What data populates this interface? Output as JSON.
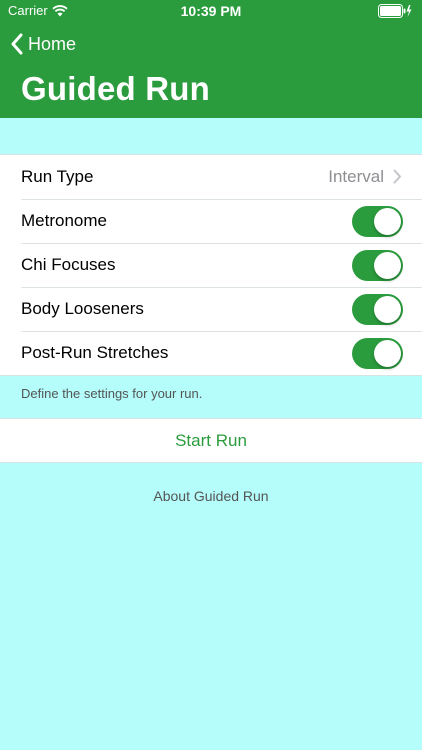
{
  "status_bar": {
    "carrier": "Carrier",
    "time": "10:39 PM"
  },
  "nav": {
    "back_label": "Home",
    "title": "Guided Run"
  },
  "settings": {
    "run_type": {
      "label": "Run Type",
      "value": "Interval"
    },
    "toggles": [
      {
        "label": "Metronome",
        "on": true
      },
      {
        "label": "Chi Focuses",
        "on": true
      },
      {
        "label": "Body Looseners",
        "on": true
      },
      {
        "label": "Post-Run Stretches",
        "on": true
      }
    ],
    "footer": "Define the settings for your run."
  },
  "actions": {
    "start_run": "Start Run",
    "about": "About Guided Run"
  },
  "colors": {
    "accent": "#2b9c3e",
    "background": "#b4fdfa"
  },
  "icons": {
    "back": "chevron-left-icon",
    "disclosure": "chevron-right-icon",
    "wifi": "wifi-icon",
    "battery": "battery-icon"
  }
}
